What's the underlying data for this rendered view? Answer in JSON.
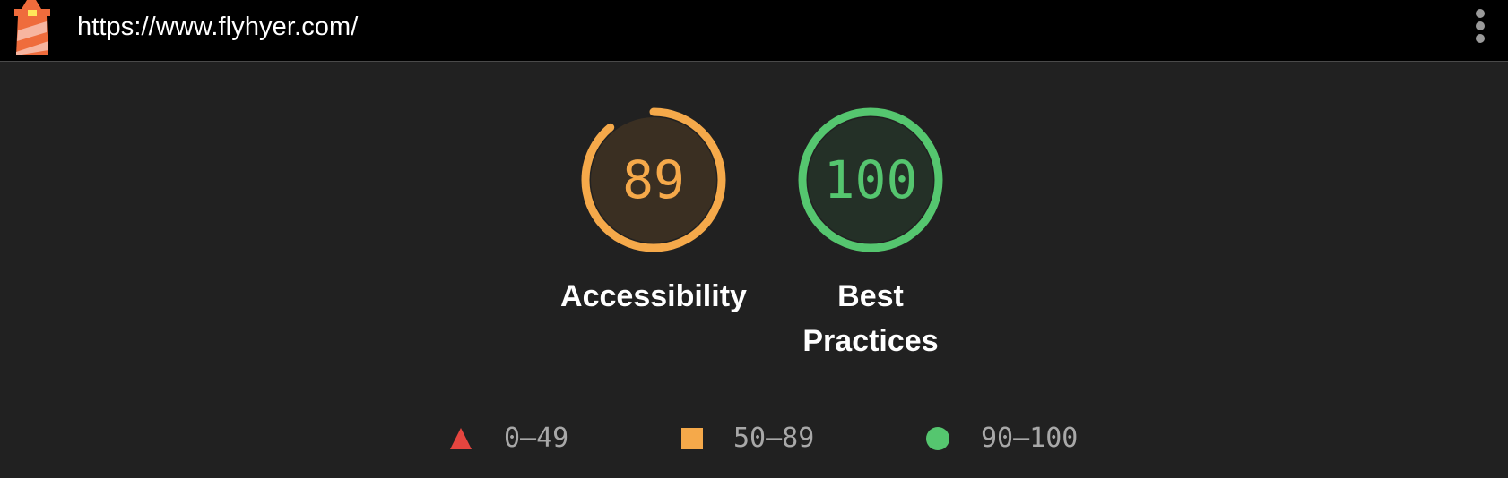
{
  "header": {
    "url": "https://www.flyhyer.com/",
    "logo_icon": "lighthouse-icon",
    "menu_icon": "more-vertical-icon"
  },
  "gauges": [
    {
      "label": "Accessibility",
      "score": "89",
      "fraction": 0.89,
      "color": "#f5a94a"
    },
    {
      "label": "Best Practices",
      "score": "100",
      "fraction": 1.0,
      "color": "#55c66f"
    }
  ],
  "legend": [
    {
      "range": "0–49",
      "icon": "triangle-icon",
      "color": "#e5453f"
    },
    {
      "range": "50–89",
      "icon": "square-icon",
      "color": "#f5a94a"
    },
    {
      "range": "90–100",
      "icon": "circle-icon",
      "color": "#55c66f"
    }
  ]
}
